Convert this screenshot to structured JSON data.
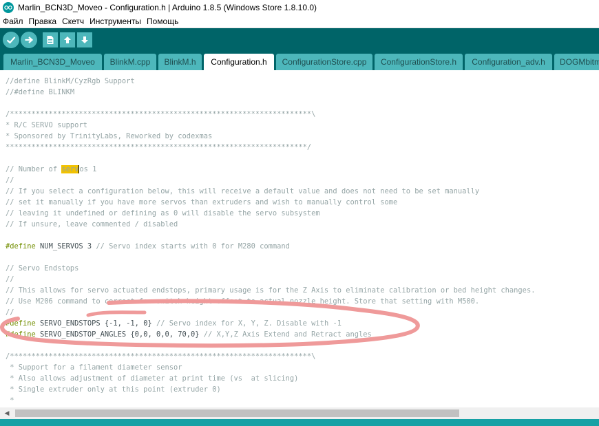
{
  "window": {
    "title": "Marlin_BCN3D_Moveo - Configuration.h | Arduino 1.8.5 (Windows Store 1.8.10.0)",
    "app_icon": "arduino-infinity-icon"
  },
  "menu": {
    "items": [
      {
        "label": "Файл"
      },
      {
        "label": "Правка"
      },
      {
        "label": "Скетч"
      },
      {
        "label": "Инструменты"
      },
      {
        "label": "Помощь"
      }
    ]
  },
  "toolbar": {
    "buttons": [
      {
        "name": "verify",
        "icon": "check-icon"
      },
      {
        "name": "upload",
        "icon": "arrow-right-icon"
      },
      {
        "name": "new",
        "icon": "document-icon"
      },
      {
        "name": "open",
        "icon": "arrow-up-icon"
      },
      {
        "name": "save",
        "icon": "arrow-down-icon"
      }
    ]
  },
  "tabs": [
    {
      "label": "Marlin_BCN3D_Moveo"
    },
    {
      "label": "BlinkM.cpp"
    },
    {
      "label": "BlinkM.h"
    },
    {
      "label": "Configuration.h",
      "active": true
    },
    {
      "label": "ConfigurationStore.cpp"
    },
    {
      "label": "ConfigurationStore.h"
    },
    {
      "label": "Configuration_adv.h"
    },
    {
      "label": "DOGMbitm"
    }
  ],
  "code": {
    "l1": "//define BlinkM/CyzRgb Support",
    "l2": "//#define BLINKM",
    "l3": "/**********************************************************************\\",
    "l4": "* R/C SERVO support",
    "l5": "* Sponsored by TrinityLabs, Reworked by codexmas",
    "l6": "**********************************************************************/",
    "l7a": "// Number of ",
    "l7b": "serv",
    "l7c": "os 1",
    "l8": "//",
    "l9": "// If you select a configuration below, this will receive a default value and does not need to be set manually",
    "l10": "// set it manually if you have more servos than extruders and wish to manually control some",
    "l11": "// leaving it undefined or defining as 0 will disable the servo subsystem",
    "l12": "// If unsure, leave commented / disabled",
    "l13k": "#define",
    "l13a": " NUM_SERVOS 3 ",
    "l13c": "// Servo index starts with 0 for M280 command",
    "l14": "// Servo Endstops",
    "l15": "//",
    "l16": "// This allows for servo actuated endstops, primary usage is for the Z Axis to eliminate calibration or bed height changes.",
    "l17": "// Use M206 command to correct for switch height offset to actual nozzle height. Store that setting with M500.",
    "l18": "//",
    "l19k": "#define",
    "l19a": " SERVO_ENDSTOPS {-1, -1, 0} ",
    "l19c": "// Servo index for X, Y, Z. Disable with -1",
    "l20k": "#define",
    "l20a": " SERVO_ENDSTOP_ANGLES {0,0, 0,0, 70,0} ",
    "l20c": "// X,Y,Z Axis Extend and Retract angles",
    "l21": "/**********************************************************************\\",
    "l22": " * Support for a filament diameter sensor",
    "l23": " * Also allows adjustment of diameter at print time (vs  at slicing)",
    "l24": " * Single extruder only at this point (extruder 0)",
    "l25": " *"
  },
  "colors": {
    "toolbar_bg": "#006468",
    "button_bg": "#4db7bb",
    "keyword": "#728e00",
    "comment": "#95a5a6",
    "highlight": "#f2c200",
    "annotation_stroke": "#ef9a9a"
  }
}
